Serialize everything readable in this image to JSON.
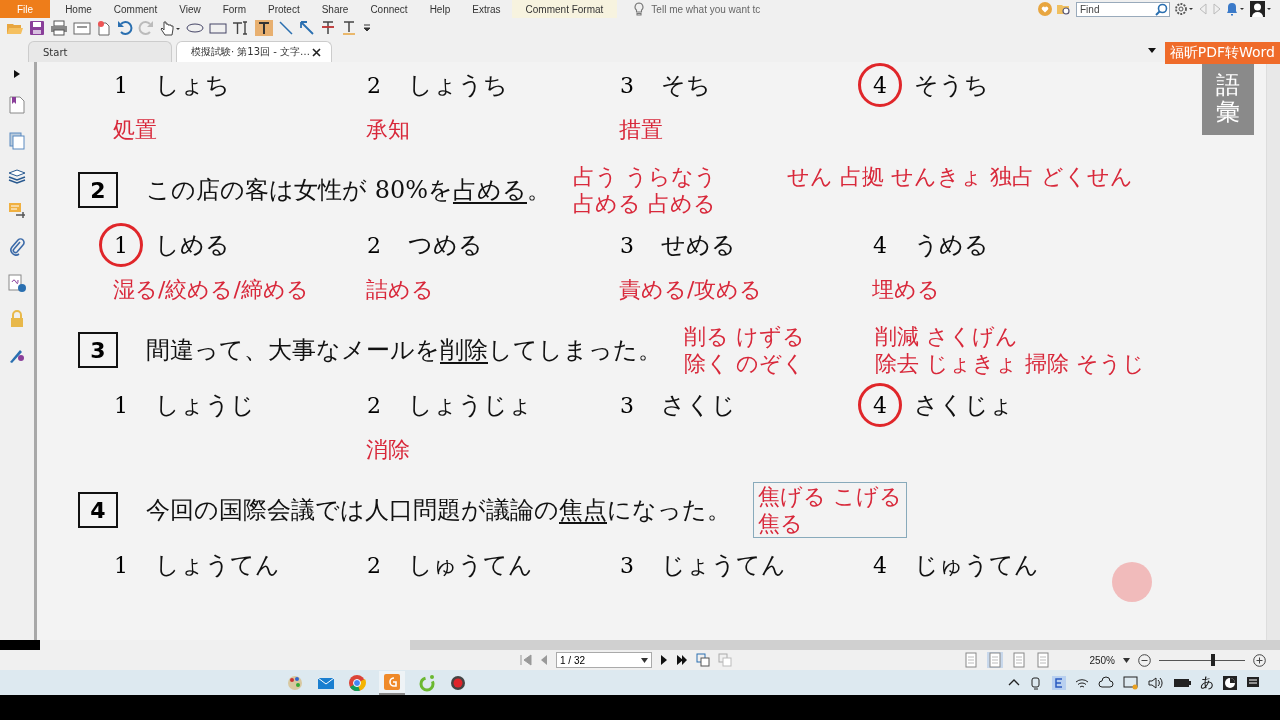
{
  "menu": [
    {
      "label": "File",
      "kind": "file"
    },
    {
      "label": "Home",
      "kind": "tab"
    },
    {
      "label": "Comment",
      "kind": "tab"
    },
    {
      "label": "View",
      "kind": "tab"
    },
    {
      "label": "Form",
      "kind": "tab"
    },
    {
      "label": "Protect",
      "kind": "tab"
    },
    {
      "label": "Share",
      "kind": "tab"
    },
    {
      "label": "Connect",
      "kind": "tab"
    },
    {
      "label": "Help",
      "kind": "tab"
    },
    {
      "label": "Extras",
      "kind": "tab"
    },
    {
      "label": "Comment Format",
      "kind": "context"
    }
  ],
  "tell_me": {
    "placeholder": "Tell me what you want tc"
  },
  "find": {
    "placeholder": "Find"
  },
  "tabs": [
    {
      "label": "Start",
      "selected": false
    },
    {
      "label": "模擬試験· 第13回 - 文字…",
      "selected": true
    }
  ],
  "convert_button": "福昕PDF转Word",
  "side_tab": "語彙",
  "document": {
    "top_options": [
      {
        "number": "1",
        "reading": "しょち",
        "circled": false,
        "note": "処置"
      },
      {
        "number": "2",
        "reading": "しょうち",
        "circled": false,
        "note": "承知"
      },
      {
        "number": "3",
        "reading": "そち",
        "circled": false,
        "note": "措置"
      },
      {
        "number": "4",
        "reading": "そうち",
        "circled": true
      }
    ],
    "questions": [
      {
        "number": "2",
        "before": "この店の客は女性が 80%を",
        "target": "占める",
        "after": "。",
        "boxed_notes": false,
        "notes": [
          [
            "占う うらなう",
            "占める 占める"
          ],
          [
            "せん 占拠 せんきょ 独占 どくせん"
          ]
        ],
        "options": [
          {
            "number": "1",
            "reading": "しめる",
            "circled": true,
            "note": "湿る/絞める/締める"
          },
          {
            "number": "2",
            "reading": "つめる",
            "circled": false,
            "note": "詰める"
          },
          {
            "number": "3",
            "reading": "せめる",
            "circled": false,
            "note": "責める/攻める"
          },
          {
            "number": "4",
            "reading": "うめる",
            "circled": false,
            "note": "埋める"
          }
        ]
      },
      {
        "number": "3",
        "before": "間違って、大事なメールを",
        "target": "削除",
        "after": "してしまった。",
        "boxed_notes": false,
        "notes": [
          [
            "削る けずる",
            "除く のぞく"
          ],
          [
            "削減 さくげん",
            "除去 じょきょ 掃除 そうじ"
          ]
        ],
        "options": [
          {
            "number": "1",
            "reading": "しょうじ",
            "circled": false
          },
          {
            "number": "2",
            "reading": "しょうじょ",
            "circled": false,
            "note": "消除"
          },
          {
            "number": "3",
            "reading": "さくじ",
            "circled": false
          },
          {
            "number": "4",
            "reading": "さくじょ",
            "circled": true
          }
        ]
      },
      {
        "number": "4",
        "before": "今回の国際会議では人口問題が議論の",
        "target": "焦点",
        "after": "になった。",
        "boxed_notes": true,
        "notes": [
          [
            "焦げる こげる",
            "焦る"
          ]
        ],
        "options": [
          {
            "number": "1",
            "reading": "しょうてん",
            "circled": false
          },
          {
            "number": "2",
            "reading": "しゅうてん",
            "circled": false
          },
          {
            "number": "3",
            "reading": "じょうてん",
            "circled": false
          },
          {
            "number": "4",
            "reading": "じゅうてん",
            "circled": false
          }
        ]
      }
    ]
  },
  "status_bar": {
    "page": "1 / 32",
    "zoom": "250%",
    "level": 0.6,
    "view_modes": [
      {
        "selected": false
      },
      {
        "selected": true
      },
      {
        "selected": false
      },
      {
        "selected": false
      }
    ]
  },
  "taskbar": {
    "input_method": "あ"
  }
}
